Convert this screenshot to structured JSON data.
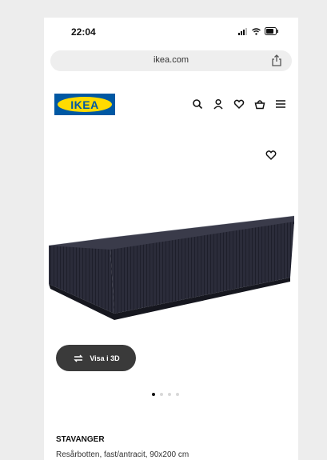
{
  "status_bar": {
    "time": "22:04",
    "icons": [
      "signal-icon",
      "wifi-icon",
      "battery-icon"
    ]
  },
  "browser": {
    "url": "ikea.com",
    "share_icon": "share-icon"
  },
  "header": {
    "logo_text": "IKEA",
    "icons": [
      "search-icon",
      "user-icon",
      "heart-icon",
      "basket-icon",
      "menu-icon"
    ]
  },
  "product": {
    "view_3d_label": "Visa i 3D",
    "name": "STAVANGER",
    "description": "Resårbotten, fast/antracit, 90x200 cm",
    "carousel_total": 4,
    "carousel_active": 1
  },
  "colors": {
    "ikea_blue": "#0058a3",
    "ikea_yellow": "#ffdb00",
    "button_dark": "#3a3a3a"
  }
}
